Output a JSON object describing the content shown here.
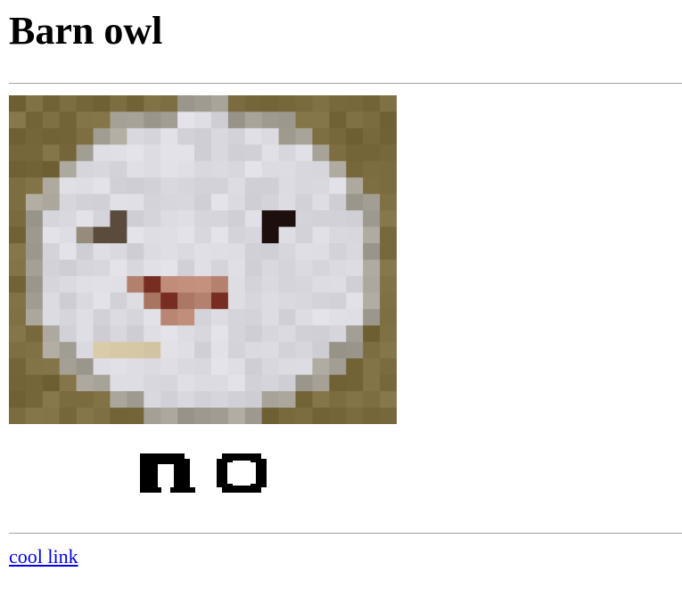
{
  "page": {
    "title": "Barn owl",
    "link_text": "cool link",
    "image_caption": "no"
  },
  "colors": {
    "link": "#0000ee",
    "rule": "#a0a0a0",
    "text": "#000000"
  },
  "icons": {
    "owl_image": "pixelated-owl-face-image",
    "caption_image": "pixel-text-no-image"
  }
}
